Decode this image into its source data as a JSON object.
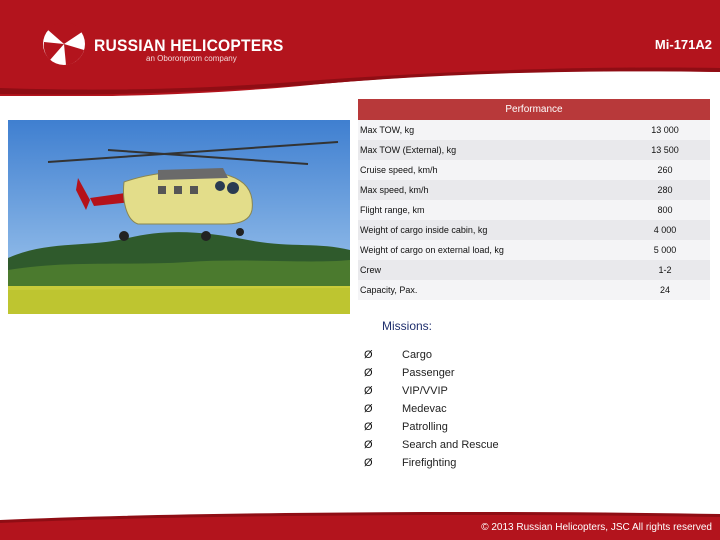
{
  "header": {
    "brand": "RUSSIAN HELICOPTERS",
    "brand_sub": "an Oboronprom company",
    "model": "Mi-171A2",
    "colors": {
      "primary": "#b3141d",
      "dark": "#8f0d14"
    }
  },
  "photo": {
    "icon": "helicopter-photo"
  },
  "performance": {
    "title": "Performance",
    "rows": [
      {
        "label": "Max TOW, kg",
        "value": "13 000"
      },
      {
        "label": "Max TOW (External), kg",
        "value": "13 500"
      },
      {
        "label": "Cruise speed, km/h",
        "value": "260"
      },
      {
        "label": "Max speed, km/h",
        "value": "280"
      },
      {
        "label": "Flight range, km",
        "value": "800"
      },
      {
        "label": "Weight of cargo inside cabin, kg",
        "value": "4 000"
      },
      {
        "label": "Weight of cargo on external load, kg",
        "value": "5 000"
      },
      {
        "label": "Crew",
        "value": "1-2"
      },
      {
        "label": "Capacity, Pax.",
        "value": "24"
      }
    ]
  },
  "missions": {
    "title": "Missions:",
    "bullet": "Ø",
    "items": [
      "Cargo",
      "Passenger",
      "VIP/VVIP",
      "Medevac",
      "Patrolling",
      "Search and Rescue",
      "Firefighting"
    ]
  },
  "footer": {
    "copyright": "© 2013 Russian Helicopters, JSC All rights reserved"
  }
}
